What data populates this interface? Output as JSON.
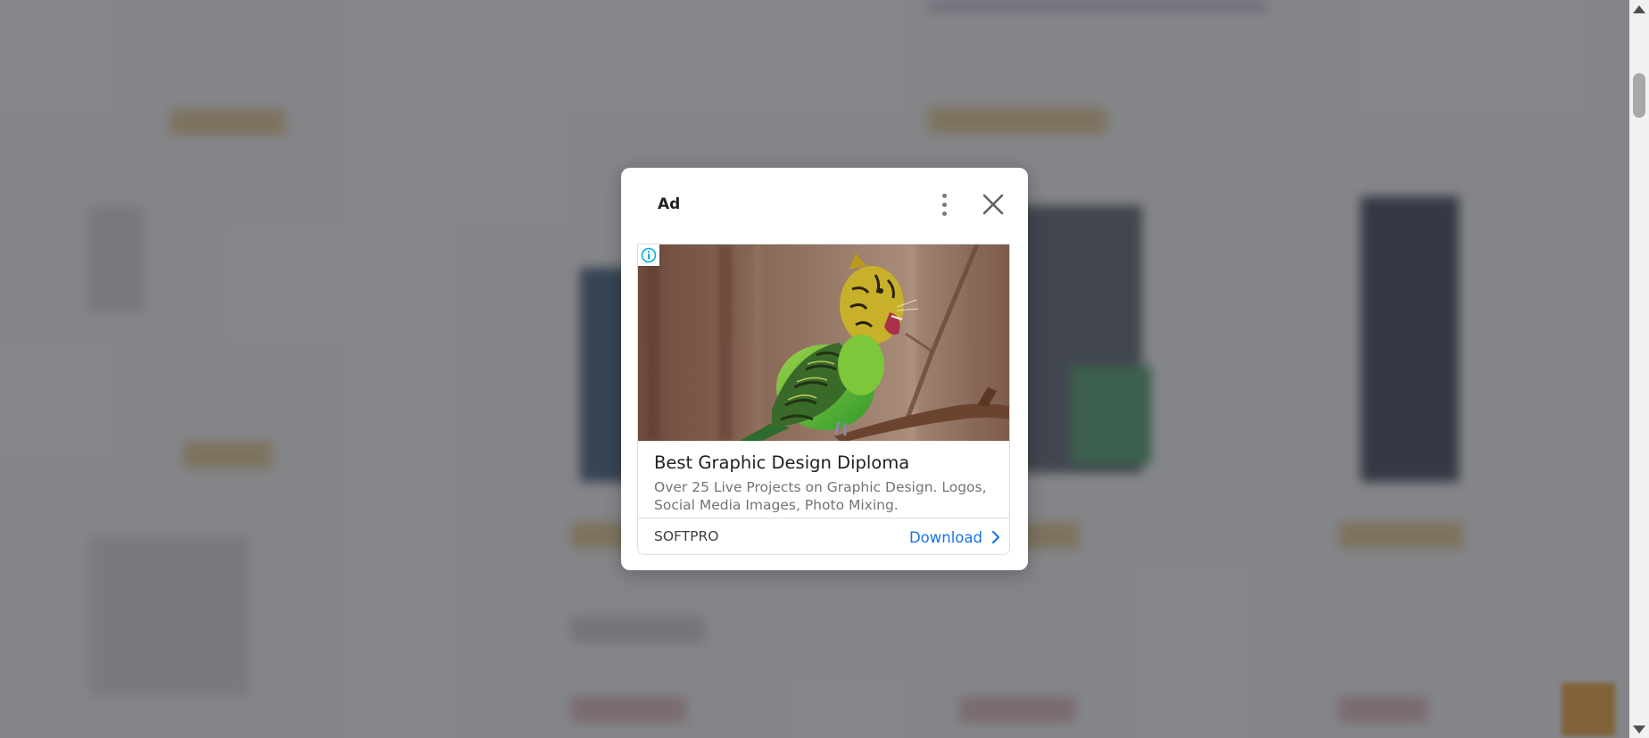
{
  "ad_dialog": {
    "label": "Ad",
    "headline": "Best Graphic Design Diploma",
    "description": "Over 25 Live Projects on Graphic Design. Logos, Social Media Images, Photo Mixing.",
    "advertiser": "SOFTPRO",
    "cta_label": "Download",
    "accent_color": "#1a73e8",
    "icons": {
      "more": "more-vert-icon",
      "close": "close-icon",
      "info": "info-icon",
      "cta": "chevron-right-icon"
    }
  }
}
